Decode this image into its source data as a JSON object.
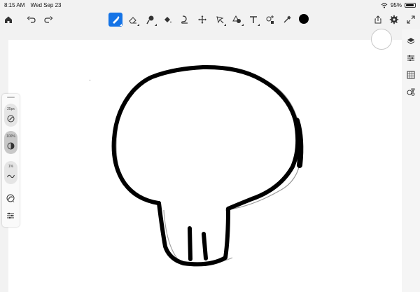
{
  "status": {
    "time": "8:15 AM",
    "date": "Wed Sep 23",
    "battery_text": "95%",
    "battery_level": 0.95
  },
  "toolbar": {
    "left_icons": [
      "home-icon",
      "undo-icon",
      "redo-icon"
    ],
    "tools": [
      "pixel-brush-icon",
      "eraser-icon",
      "smudge-icon",
      "fill-icon",
      "liquify-icon",
      "transform-icon",
      "selection-icon",
      "shape-icon",
      "text-icon",
      "image-insert-icon",
      "eyedropper-icon"
    ],
    "active_tool": "pixel-brush-icon",
    "current_color": "#000000",
    "right_icons": [
      "share-icon",
      "settings-icon",
      "fullscreen-icon"
    ]
  },
  "right_rail": {
    "icons": [
      "layers-icon",
      "layer-properties-icon",
      "grid-icon",
      "shapes-icon"
    ]
  },
  "brush_panel": {
    "size_label": "25px",
    "opacity_label": "100%",
    "smoothing_label": "1%"
  },
  "colors": {
    "accent": "#1473e6",
    "canvas": "#ffffff",
    "background": "#f2f2f2",
    "stroke": "#000000"
  }
}
